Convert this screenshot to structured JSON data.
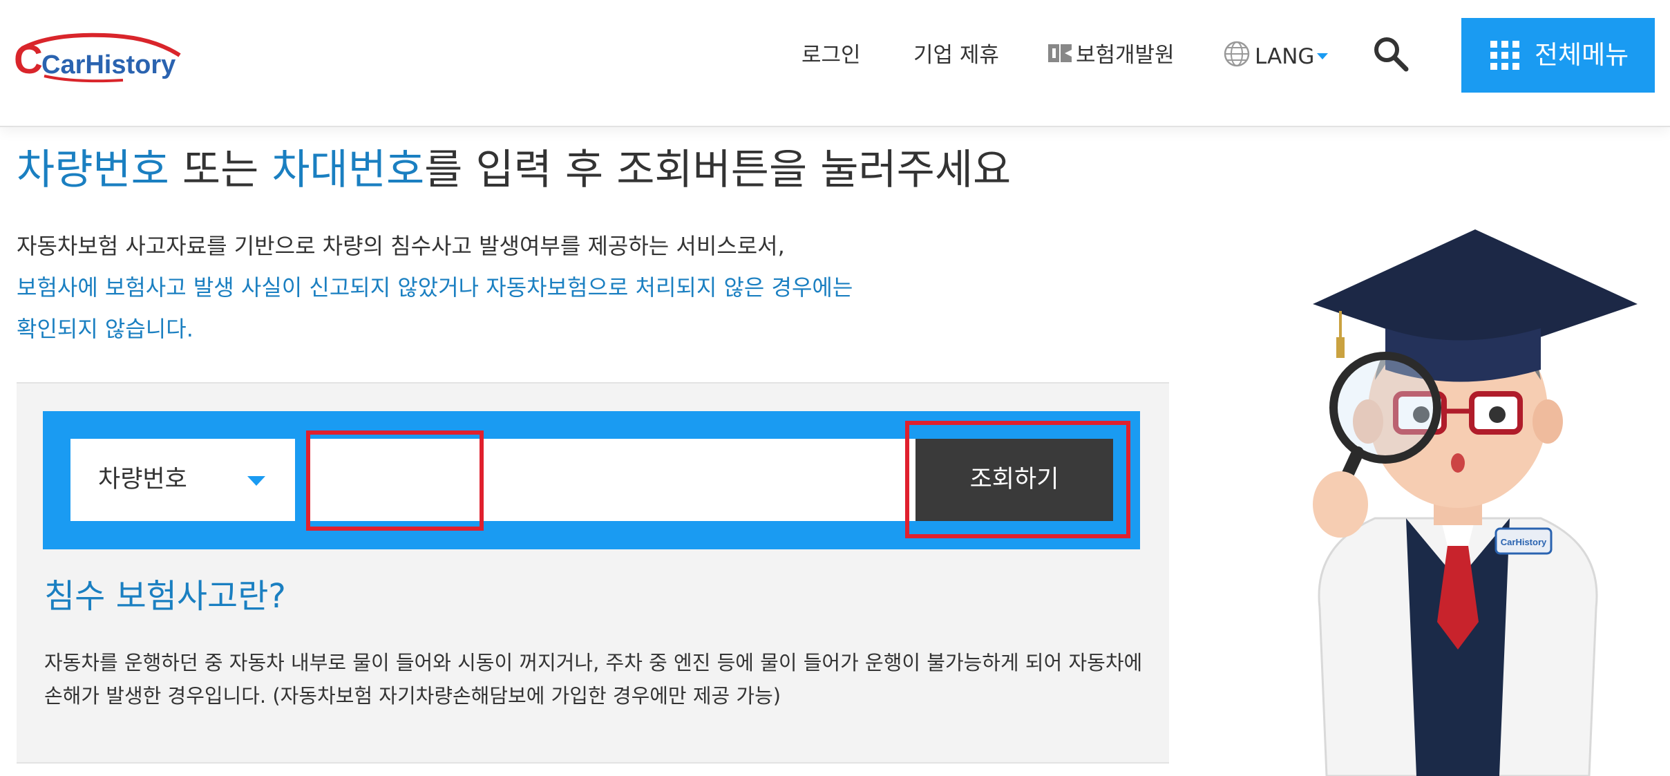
{
  "logo": {
    "text": "CarHistory"
  },
  "nav": {
    "login": "로그인",
    "partner": "기업 제휴",
    "kidi": "보험개발원",
    "lang": "LANG",
    "menu": "전체메뉴"
  },
  "headline": {
    "part1": "차량번호",
    "part2": " 또는 ",
    "part3": "차대번호",
    "part4": "를 입력 후 조회버튼을 눌러주세요"
  },
  "desc": {
    "line1": "자동차보험 사고자료를 기반으로 차량의 침수사고 발생여부를 제공하는 서비스로서,",
    "line2": "보험사에 보험사고 발생 사실이 신고되지 않았거나 자동차보험으로 처리되지 않은 경우에는",
    "line3": "확인되지 않습니다."
  },
  "search": {
    "select_value": "차량번호",
    "input_value": "",
    "button": "조회하기"
  },
  "info": {
    "title": "침수 보험사고란?",
    "body_line1": "자동차를 운행하던 중 자동차 내부로 물이 들어와 시동이 꺼지거나, 주차 중 엔진 등에 물이 들어가 운행이 불가능하게 되어 자동차에",
    "body_line2": "손해가 발생한 경우입니다. (자동차보험 자기차량손해담보에 가입한 경우에만 제공 가능)"
  },
  "mascot": {
    "badge": "CarHistory"
  },
  "colors": {
    "accent": "#1a9bf2",
    "link_blue": "#1a7fc1",
    "button_dark": "#3a3a3a",
    "highlight_red": "#e0202e",
    "logo_red": "#d9252b"
  },
  "icons": [
    "kidi-logo-icon",
    "globe-icon",
    "caret-down-icon",
    "search-icon",
    "grid-menu-icon",
    "chevron-down-icon"
  ]
}
